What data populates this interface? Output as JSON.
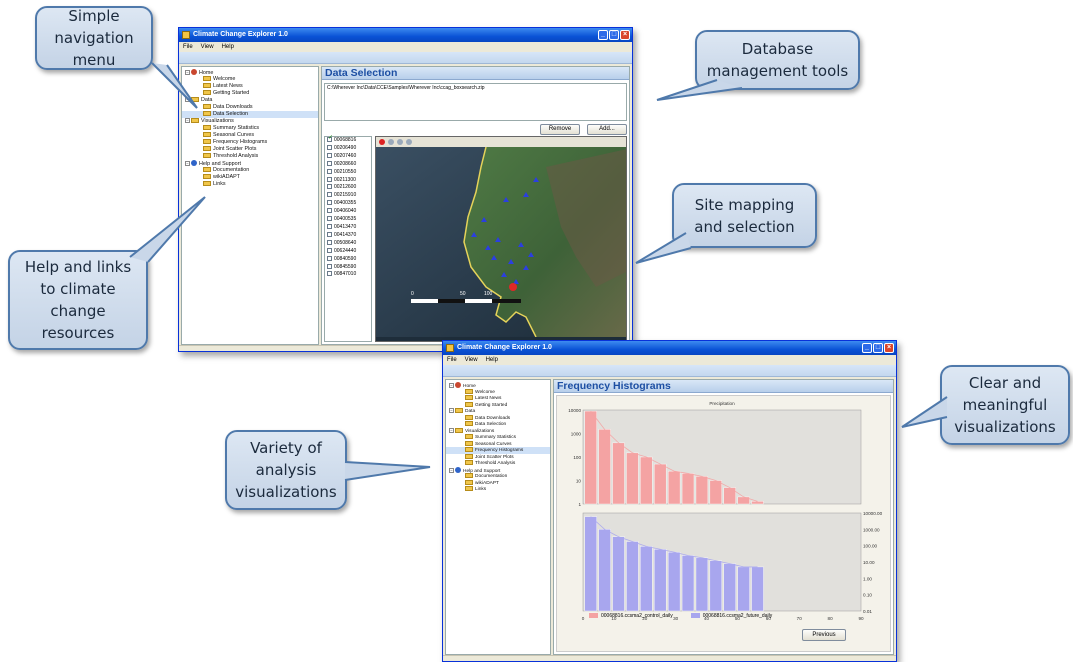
{
  "callouts": {
    "navigation": "Simple\nnavigation\nmenu",
    "database": "Database\nmanagement tools",
    "mapping": "Site mapping\nand selection",
    "help": "Help and links\nto climate\nchange\nresources",
    "variety": "Variety of\nanalysis\nvisualizations",
    "clear": "Clear and\nmeaningful\nvisualizations"
  },
  "window1": {
    "title": "Climate Change Explorer 1.0",
    "menu": [
      "File",
      "View",
      "Help"
    ],
    "panel_title": "Data Selection",
    "path": "C:\\Wherever Inc\\Data\\CCE\\Samples\\Wherever Inc\\ccag_boxsearch.zip",
    "remove_label": "Remove",
    "add_label": "Add...",
    "sites": [
      {
        "id": "00068816",
        "checked": true
      },
      {
        "id": "00206490",
        "checked": false
      },
      {
        "id": "00207460",
        "checked": false
      },
      {
        "id": "00208660",
        "checked": false
      },
      {
        "id": "00210550",
        "checked": false
      },
      {
        "id": "00211300",
        "checked": false
      },
      {
        "id": "00212600",
        "checked": false
      },
      {
        "id": "00215910",
        "checked": false
      },
      {
        "id": "00400355",
        "checked": false
      },
      {
        "id": "00406040",
        "checked": false
      },
      {
        "id": "00400535",
        "checked": false
      },
      {
        "id": "00413470",
        "checked": false
      },
      {
        "id": "00414370",
        "checked": false
      },
      {
        "id": "00508640",
        "checked": false
      },
      {
        "id": "00624440",
        "checked": false
      },
      {
        "id": "00840590",
        "checked": false
      },
      {
        "id": "00845590",
        "checked": false
      },
      {
        "id": "00847010",
        "checked": false
      }
    ],
    "scale_labels": [
      "0",
      "50",
      "100"
    ]
  },
  "window2": {
    "title": "Climate Change Explorer 1.0",
    "menu": [
      "File",
      "View",
      "Help"
    ],
    "panel_title": "Frequency Histograms",
    "previous_label": "Previous"
  },
  "tree": {
    "home": "Home",
    "welcome": "Welcome",
    "latest_news": "Latest News",
    "getting_started": "Getting Started",
    "data": "Data",
    "data_downloads": "Data Downloads",
    "data_selection": "Data Selection",
    "visualizations": "Visualizations",
    "summary_statistics": "Summary Statistics",
    "seasonal_curves": "Seasonal Curves",
    "frequency_histograms": "Frequency Histograms",
    "joint_scatter_plots": "Joint Scatter Plots",
    "threshold_analysis": "Threshold Analysis",
    "help_and_support": "Help and Support",
    "documentation": "Documentation",
    "wikiadapt": "wikiADAPT",
    "links": "Links"
  },
  "colors": {
    "control": "#f4a3a3",
    "future": "#a8a6ee",
    "callout_border": "#4f79ab"
  },
  "chart_data": {
    "type": "bar",
    "title": "Precipitation",
    "x_ticks": [
      "0",
      "10",
      "20",
      "30",
      "40",
      "50",
      "60",
      "70",
      "80",
      "90"
    ],
    "xlim": [
      0,
      90
    ],
    "bin_width": 4.5,
    "top_y_ticks": [
      "10000",
      "1000",
      "100",
      "10",
      "1"
    ],
    "bottom_y_ticks": [
      "10000.00",
      "1000.00",
      "100.00",
      "10.00",
      "1.00",
      "0.10",
      "0.01"
    ],
    "log_scale": true,
    "series": [
      {
        "name": "00068816.ccsma2_control_daily",
        "color": "#f4a3a3",
        "x": [
          2.5,
          7,
          11.5,
          16,
          20.5,
          25,
          29.5,
          34,
          38.5,
          43,
          47.5,
          52,
          56.5
        ],
        "values": [
          9000,
          1500,
          400,
          150,
          100,
          50,
          25,
          20,
          15,
          10,
          5,
          2,
          1.3
        ]
      },
      {
        "name": "00068816.ccsma2_future_daily",
        "color": "#a8a6ee",
        "x": [
          2.5,
          7,
          11.5,
          16,
          20.5,
          25,
          29.5,
          34,
          38.5,
          43,
          47.5,
          52,
          56.5
        ],
        "values": [
          6000,
          1000,
          350,
          180,
          90,
          60,
          40,
          25,
          18,
          12,
          8,
          5,
          5
        ]
      }
    ]
  }
}
